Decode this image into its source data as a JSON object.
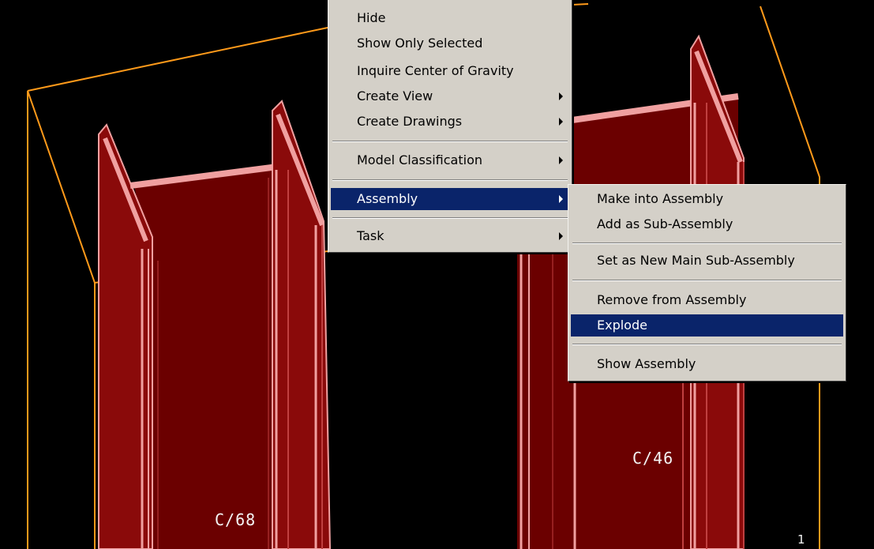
{
  "viewport": {
    "parts": [
      {
        "mark": "C/68"
      },
      {
        "mark": "C/46"
      }
    ],
    "corner_value": "1"
  },
  "context_menu": {
    "items": [
      {
        "label": "Hide"
      },
      {
        "label": "Show Only Selected"
      },
      {
        "label": "Inquire Center of Gravity"
      },
      {
        "label": "Create View",
        "has_submenu": true
      },
      {
        "label": "Create Drawings",
        "has_submenu": true
      },
      {
        "label": "Model Classification",
        "has_submenu": true
      },
      {
        "label": "Assembly",
        "has_submenu": true,
        "highlighted": true
      },
      {
        "label": "Task",
        "has_submenu": true
      }
    ]
  },
  "assembly_submenu": {
    "items": [
      {
        "label": "Make into Assembly"
      },
      {
        "label": "Add as Sub-Assembly"
      },
      {
        "label": "Set as New Main Sub-Assembly"
      },
      {
        "label": "Remove from Assembly"
      },
      {
        "label": "Explode",
        "highlighted": true
      },
      {
        "label": "Show Assembly"
      }
    ]
  },
  "colors": {
    "menu_background": "#d4d0c8",
    "highlight": "#0a246a",
    "part_fill": "#6e0000",
    "part_edge": "#f0a0a0",
    "selection_box": "#ff9a1a"
  }
}
